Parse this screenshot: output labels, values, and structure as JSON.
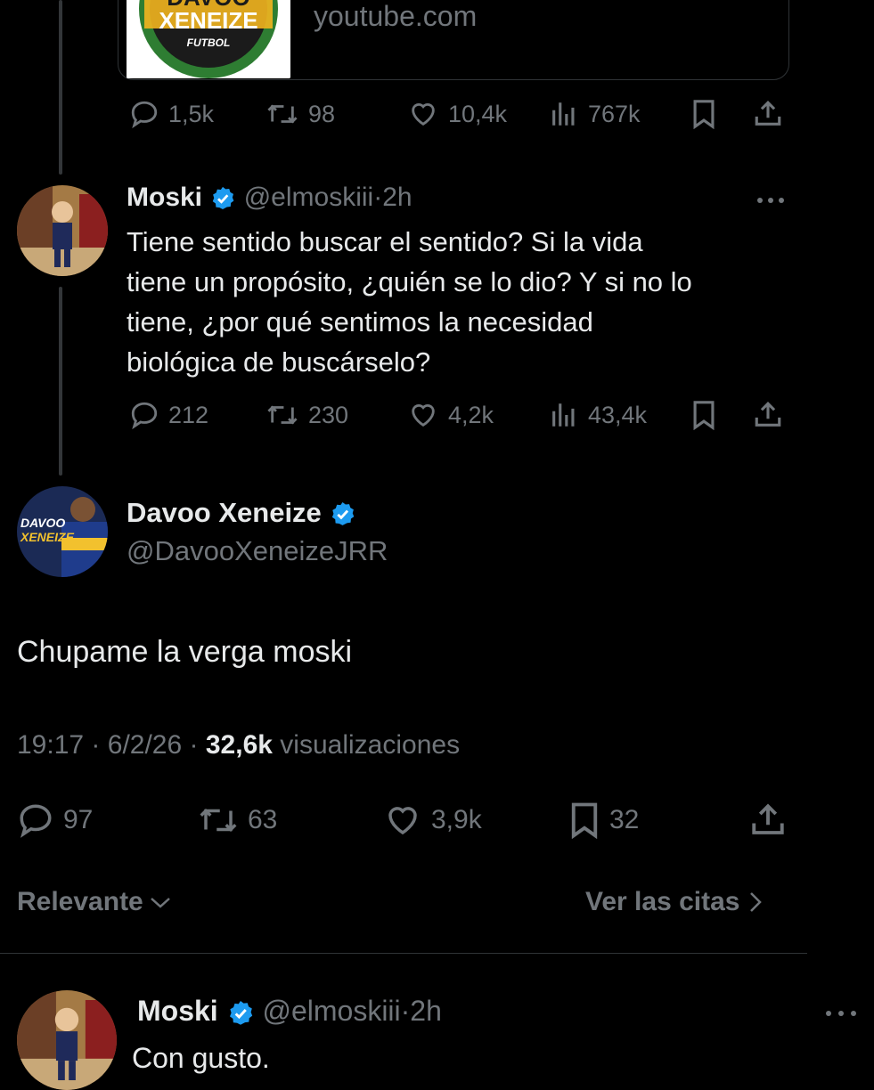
{
  "card": {
    "domain": "youtube.com",
    "thumb_line1": "DAVOO",
    "thumb_line2": "XENEIZE",
    "thumb_line3": "FUTBOL"
  },
  "tweet1_actions": {
    "replies": "1,5k",
    "retweets": "98",
    "likes": "10,4k",
    "views": "767k"
  },
  "reply1": {
    "name": "Moski",
    "handle": "@elmoskiii",
    "sep": "·",
    "time": "2h",
    "text": [
      "Tiene sentido buscar el sentido? Si la vida",
      "tiene un propósito, ¿quién se lo dio? Y si no lo",
      "tiene, ¿por qué sentimos la necesidad",
      "biológica de buscárselo?"
    ],
    "replies": "212",
    "retweets": "230",
    "likes": "4,2k",
    "views": "43,4k"
  },
  "main": {
    "name": "Davoo Xeneize",
    "handle": "@DavooXeneizeJRR",
    "avatar_text1": "DAVOO",
    "avatar_text2": "XENEIZE",
    "text": "Chupame la verga moski",
    "time": "19:17",
    "sep1": "·",
    "date": "6/2/26",
    "sep2": "·",
    "views_count": "32,6k",
    "views_label": "visualizaciones",
    "replies": "97",
    "retweets": "63",
    "likes": "3,9k",
    "bookmarks": "32"
  },
  "filter": {
    "sort_label": "Relevante",
    "quotes_label": "Ver las citas"
  },
  "reply2": {
    "name": "Moski",
    "handle": "@elmoskiii",
    "sep": "·",
    "time": "2h",
    "text": "Con gusto."
  },
  "colors": {
    "background": "#000000",
    "text": "#e7e9ea",
    "muted": "#71767b",
    "verified": "#1d9bf0",
    "border": "#2f3336"
  }
}
